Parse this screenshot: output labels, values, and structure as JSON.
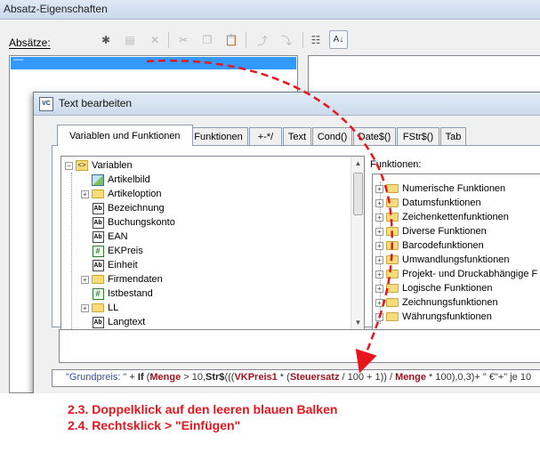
{
  "outer_window": {
    "title": "Absatz-Eigenschaften",
    "list_label": "Absätze:",
    "selected_item_text": "—"
  },
  "inner_window": {
    "title": "Text bearbeiten",
    "icon_text": "VC",
    "tabs": [
      {
        "label": "Variablen und Funktionen",
        "active": true
      },
      {
        "label": "Funktionen",
        "active": false
      },
      {
        "label": "+-*/",
        "active": false
      },
      {
        "label": "Text",
        "active": false
      },
      {
        "label": "Cond()",
        "active": false
      },
      {
        "label": "Date$()",
        "active": false
      },
      {
        "label": "FStr$()",
        "active": false
      },
      {
        "label": "Tab",
        "active": false
      }
    ],
    "tree": {
      "root": {
        "label": "Variablen",
        "icon": "variables-icon",
        "toggle": "−"
      },
      "items": [
        {
          "label": "Artikelbild",
          "icon": "image-icon",
          "toggle": ""
        },
        {
          "label": "Artikeloption",
          "icon": "folder-icon",
          "toggle": "+"
        },
        {
          "label": "Bezeichnung",
          "icon": "text-field-icon",
          "toggle": ""
        },
        {
          "label": "Buchungskonto",
          "icon": "text-field-icon",
          "toggle": ""
        },
        {
          "label": "EAN",
          "icon": "text-field-icon",
          "toggle": ""
        },
        {
          "label": "EKPreis",
          "icon": "number-field-icon",
          "toggle": ""
        },
        {
          "label": "Einheit",
          "icon": "text-field-icon",
          "toggle": ""
        },
        {
          "label": "Firmendaten",
          "icon": "folder-icon",
          "toggle": "+"
        },
        {
          "label": "Istbestand",
          "icon": "number-field-icon",
          "toggle": ""
        },
        {
          "label": "LL",
          "icon": "folder-icon",
          "toggle": "+"
        },
        {
          "label": "Langtext",
          "icon": "text-field-icon",
          "toggle": ""
        }
      ],
      "field_icon_text": "Ab",
      "number_icon_text": "#"
    },
    "functions": {
      "label": "Funktionen:",
      "items": [
        "Numerische Funktionen",
        "Datumsfunktionen",
        "Zeichenkettenfunktionen",
        "Diverse Funktionen",
        "Barcodefunktionen",
        "Umwandlungsfunktionen",
        "Projekt- und Druckabhängige F",
        "Logische Funktionen",
        "Zeichnungsfunktionen",
        "Währungsfunktionen"
      ],
      "toggle": "+"
    },
    "formula": [
      {
        "t": "\"Grundpreis: \"",
        "k": "str"
      },
      {
        "t": " + ",
        "k": "op"
      },
      {
        "t": "If",
        "k": "kw"
      },
      {
        "t": " (",
        "k": "op"
      },
      {
        "t": "Menge",
        "k": "var"
      },
      {
        "t": " > 10,",
        "k": "op"
      },
      {
        "t": "Str$",
        "k": "kw"
      },
      {
        "t": "(((",
        "k": "op"
      },
      {
        "t": "VKPreis1",
        "k": "var"
      },
      {
        "t": " * (",
        "k": "op"
      },
      {
        "t": "Steuersatz",
        "k": "var"
      },
      {
        "t": " / 100 + 1)) / ",
        "k": "op"
      },
      {
        "t": "Menge",
        "k": "var"
      },
      {
        "t": " * 100),0,3)+ \" €\"+\" je 10",
        "k": "op"
      }
    ]
  },
  "annotations": {
    "step1": "2.3.  Doppelklick auf den leeren blauen Balken",
    "step2": "2.4.  Rechtsklick > \"Einfügen\"",
    "arrow_color": "#e8161c"
  }
}
